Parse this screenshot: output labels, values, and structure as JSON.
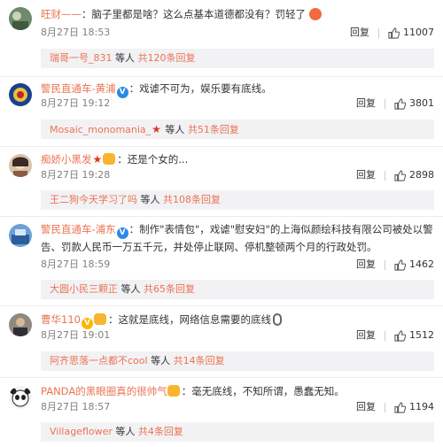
{
  "comments": [
    {
      "user": "旺财——",
      "text": "：脑子里都是啥？这么点基本道德都没有？罚轻了",
      "time": "8月27日 18:53",
      "reply": "回复",
      "likes": "11007",
      "sub_user": "瑞哥一号_831",
      "sub_mid": " 等人 ",
      "sub_more": "共120条回复"
    },
    {
      "user": "警民直通车-黄浦",
      "text": "：戏谑不可为，娱乐要有底线。",
      "time": "8月27日 19:12",
      "reply": "回复",
      "likes": "3801",
      "sub_user": "Mosaic_monomania_",
      "sub_mid": " 等人 ",
      "sub_more": "共51条回复"
    },
    {
      "user": "痴娇小黑发",
      "text": "：还是个女的...",
      "time": "8月27日 19:28",
      "reply": "回复",
      "likes": "2898",
      "sub_user": "王二狗今天学习了吗",
      "sub_mid": " 等人 ",
      "sub_more": "共108条回复"
    },
    {
      "user": "警民直通车-浦东",
      "text": "：制作\"表情包\"，戏谑\"慰安妇\"的上海似颜绘科技有限公司被处以警告、罚款人民币一万五千元，并处停止联网、停机整顿两个月的行政处罚。",
      "time": "8月27日 18:59",
      "reply": "回复",
      "likes": "1462",
      "sub_user": "大圆小民三颗正",
      "sub_mid": " 等人 ",
      "sub_more": "共65条回复"
    },
    {
      "user": "曹华110",
      "text": "：这就是底线，网络信息需要的底线",
      "time": "8月27日 19:01",
      "reply": "回复",
      "likes": "1512",
      "sub_user": "阿齐思落一点都不cool",
      "sub_mid": " 等人 ",
      "sub_more": "共14条回复"
    },
    {
      "user": "PANDA的黑眼圈真的很帅气",
      "text": "：毫无底线，不知所谓，愚蠢无知。",
      "time": "8月27日 18:57",
      "reply": "回复",
      "likes": "1194",
      "sub_user": "Villageflower",
      "sub_mid": " 等人 ",
      "sub_more": "共4条回复"
    }
  ],
  "icons": {
    "like": "thumbs-up-icon",
    "verified": "verified-v-icon",
    "emoji": "angry-face-icon",
    "mic": "microphone-icon"
  },
  "colors": {
    "username": "#eb7350",
    "verified_gold": "#ffb400",
    "verified_blue": "#2a8ae8",
    "subbox_bg": "#f2f2f5"
  }
}
